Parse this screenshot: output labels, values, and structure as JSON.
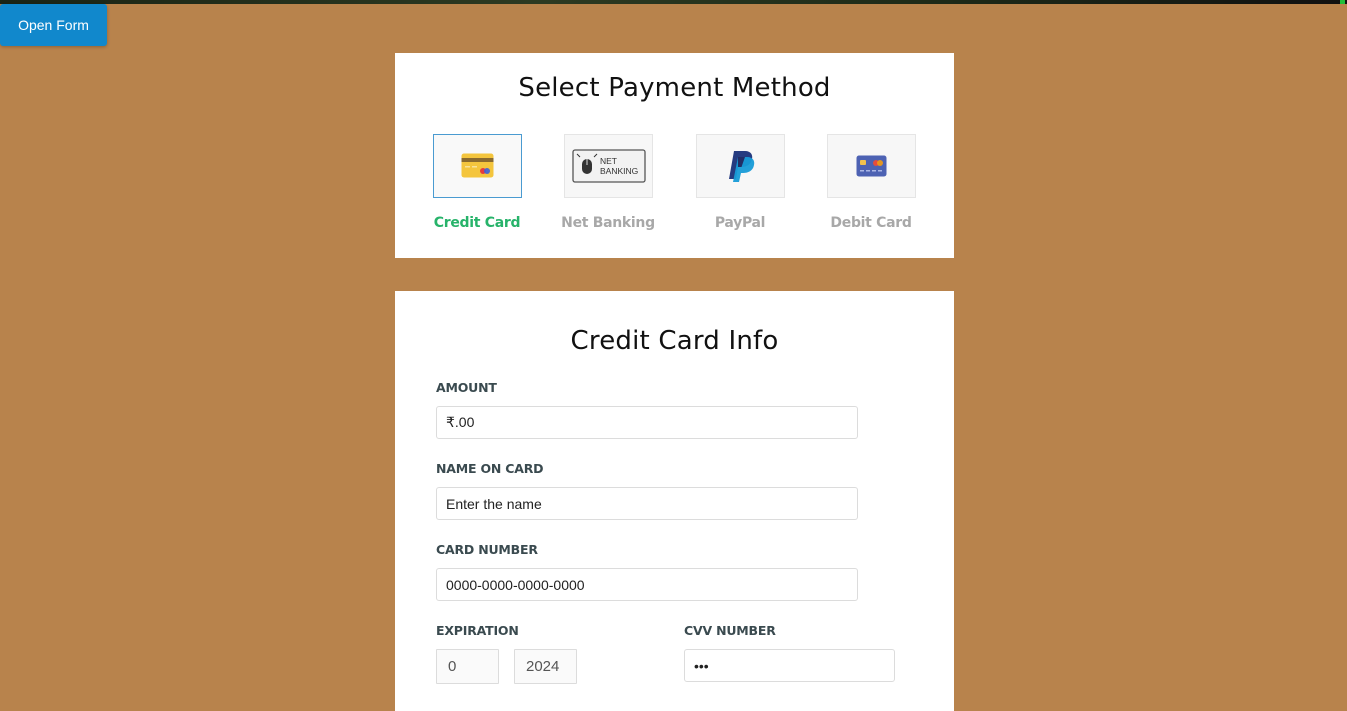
{
  "open_button": {
    "label": "Open Form"
  },
  "payment": {
    "title": "Select Payment Method",
    "options": [
      {
        "label": "Credit Card",
        "icon": "credit-card-icon",
        "active": true
      },
      {
        "label": "Net Banking",
        "icon": "net-banking-icon",
        "active": false,
        "icon_text": [
          "NET",
          "BANKING"
        ]
      },
      {
        "label": "PayPal",
        "icon": "paypal-icon",
        "active": false
      },
      {
        "label": "Debit Card",
        "icon": "debit-card-icon",
        "active": false
      }
    ]
  },
  "form": {
    "title": "Credit Card Info",
    "amount": {
      "label": "AMOUNT",
      "value": "₹.00"
    },
    "name": {
      "label": "NAME ON CARD",
      "placeholder": "Enter the name"
    },
    "card_number": {
      "label": "CARD NUMBER",
      "placeholder": "0000-0000-0000-0000"
    },
    "expiration": {
      "label": "EXPIRATION",
      "month": "0",
      "year": "2024"
    },
    "cvv": {
      "label": "CVV NUMBER",
      "value": "•••"
    }
  },
  "colors": {
    "background": "#b8834c",
    "button": "#1188cc",
    "active_label": "#27b36a",
    "inactive_label": "#a8a8a8",
    "active_border": "#4a9bd1"
  }
}
